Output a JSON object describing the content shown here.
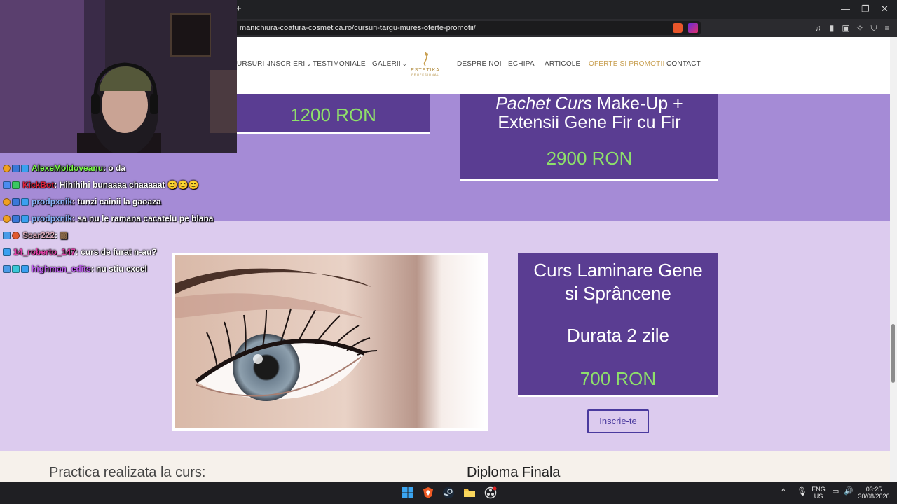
{
  "browser": {
    "new_tab_symbol": "+",
    "url": "manichiura-coafura-cosmetica.ro/cursuri-targu-mures-oferte-promotii/",
    "window_controls": [
      "—",
      "❐",
      "✕"
    ]
  },
  "nav": {
    "items": [
      {
        "label": "URSURI",
        "dropdown": true
      },
      {
        "label": "INSCRIERI",
        "dropdown": true
      },
      {
        "label": "TESTIMONIALE",
        "dropdown": false
      },
      {
        "label": "GALERII",
        "dropdown": true
      },
      {
        "label": "DESPRE NOI",
        "dropdown": false
      },
      {
        "label": "ECHIPA",
        "dropdown": false
      },
      {
        "label": "ARTICOLE",
        "dropdown": false
      },
      {
        "label": "OFERTE SI PROMOTII",
        "dropdown": true,
        "active": true
      },
      {
        "label": "CONTACT",
        "dropdown": false
      }
    ],
    "logo_name": "ESTETIKA",
    "logo_sub": "PROFESIONAL",
    "chevron": "⌄"
  },
  "offers": {
    "box1_price": "1200 RON",
    "box2_title_italic": "Pachet Curs",
    "box2_title_rest": " Make-Up +",
    "box2_title_line2": "Extensii Gene Fir cu Fir",
    "box2_price": "2900 RON",
    "box3_title_line1": "Curs Laminare Gene",
    "box3_title_line2": "si Sprâncene",
    "box3_duration": "Durata 2 zile",
    "box3_price": "700 RON",
    "register_button": "Inscrie-te"
  },
  "sections": {
    "practice_title": "Practica realizata la curs:",
    "diploma_title": "Diploma Finala"
  },
  "chat": [
    {
      "user": "AlexeMoldoveanu",
      "message": "o da",
      "color": "#7cfc4a",
      "badges": [
        "#f0a020",
        "#3a78d8",
        "#3aa0f0"
      ]
    },
    {
      "user": "KickBot",
      "message": "Hihihihi bunaaaa chaaaaat 😊😊😊",
      "color": "#e0203a",
      "badges": [
        "#4a8cf0",
        "#3ac860"
      ]
    },
    {
      "user": "prodpxnik",
      "message": "tunzi cainii la gaoaza",
      "color": "#8ab4f8",
      "badges": [
        "#f0a020",
        "#3a78d8",
        "#3aa0f0"
      ]
    },
    {
      "user": "prodpxnik",
      "message": "sa nu le ramana cacatelu pe blana",
      "color": "#8ab4f8",
      "badges": [
        "#f0a020",
        "#3a78d8",
        "#3aa0f0"
      ]
    },
    {
      "user": "Scar222",
      "message": "▩",
      "color": "#d8a8b8",
      "badges": [
        "#4a9ce8",
        "#e05a30"
      ]
    },
    {
      "user": "14_roberto_147",
      "message": "curs de furat n-au?",
      "color": "#e040a8",
      "badges": [
        "#3aa0f0"
      ]
    },
    {
      "user": "highman_edits",
      "message": "nu stiu excel",
      "color": "#c060f0",
      "badges": [
        "#4a9ce8",
        "#3ac8d8",
        "#3aa0f0"
      ]
    }
  ],
  "taskbar": {
    "lang_line1": "ENG",
    "lang_line2": "US",
    "time": "03:25",
    "date": "30/08/2026",
    "tray_arrow": "^"
  },
  "colors": {
    "accent_purple": "#5a3d92",
    "band_purple": "#a58bd6",
    "light_lilac": "#dccbee",
    "price_green": "#8ee06a",
    "nav_active": "#c9a052"
  }
}
